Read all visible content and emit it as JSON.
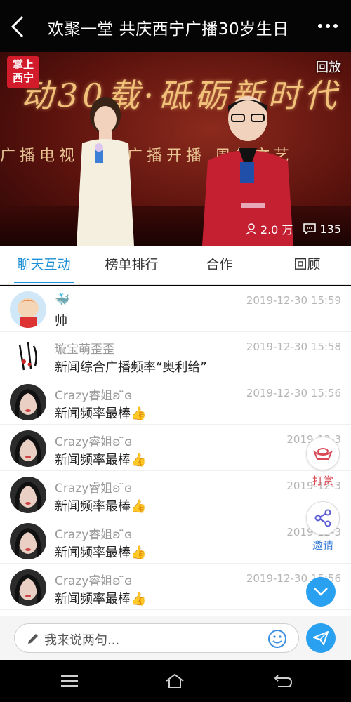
{
  "header": {
    "title": "欢聚一堂 共庆西宁广播30岁生日"
  },
  "video": {
    "logo_text": "掌上西宁",
    "replay_badge": "回放",
    "banner_text": "动30载·砥砺新时代",
    "subbanner_text": "广播电视 纪念广播开播 周年文艺",
    "viewers": "2.0 万",
    "comments": "135"
  },
  "tabs": [
    {
      "label": "聊天互动",
      "active": true
    },
    {
      "label": "榜单排行",
      "active": false
    },
    {
      "label": "合作",
      "active": false
    },
    {
      "label": "回顾",
      "active": false
    }
  ],
  "messages": [
    {
      "user": "🐳",
      "time": "2019-12-30 15:59",
      "text": "帅"
    },
    {
      "user": "璇宝萌歪歪",
      "time": "2019-12-30 15:58",
      "text": "新闻综合广播频率“奥利给”"
    },
    {
      "user": "Crazy睿姐ʚ ̈ɞ",
      "time": "2019-12-30 15:56",
      "text": "新闻频率最棒👍"
    },
    {
      "user": "Crazy睿姐ʚ ̈ɞ",
      "time": "2019-12-3",
      "text": "新闻频率最棒👍"
    },
    {
      "user": "Crazy睿姐ʚ ̈ɞ",
      "time": "2019-12-3",
      "text": "新闻频率最棒👍"
    },
    {
      "user": "Crazy睿姐ʚ ̈ɞ",
      "time": "2019-12-3",
      "text": "新闻频率最棒👍"
    },
    {
      "user": "Crazy睿姐ʚ ̈ɞ",
      "time": "2019-12-30 15:56",
      "text": "新闻频率最棒👍"
    }
  ],
  "side": {
    "reward_label": "打赏",
    "invite_label": "邀请"
  },
  "input": {
    "placeholder": "我来说两句..."
  },
  "colors": {
    "accent": "#1b8fd6",
    "send_button": "#2aa0f0",
    "reward_text": "#d84a55"
  }
}
